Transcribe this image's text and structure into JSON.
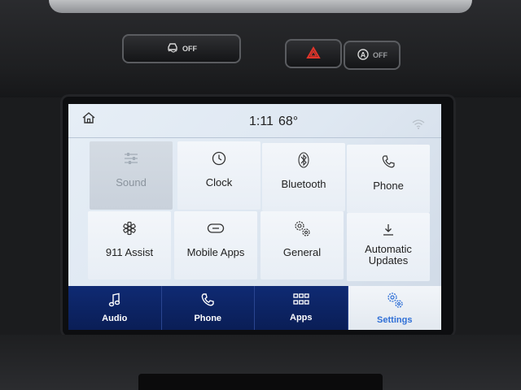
{
  "hardware_buttons": {
    "traction_off_label": "OFF",
    "hazard_icon": "hazard-triangle-icon",
    "auto_stop_label": "OFF"
  },
  "status_bar": {
    "time": "1:11",
    "temperature": "68°",
    "home_icon": "home-icon",
    "wifi_icon": "wifi-icon"
  },
  "tiles": [
    {
      "label": "Sound",
      "icon": "sliders-icon",
      "enabled": false
    },
    {
      "label": "Clock",
      "icon": "clock-icon",
      "enabled": true
    },
    {
      "label": "Bluetooth",
      "icon": "bluetooth-icon",
      "enabled": true
    },
    {
      "label": "Phone",
      "icon": "phone-icon",
      "enabled": true
    },
    {
      "label": "911 Assist",
      "icon": "asterisk-icon",
      "enabled": true
    },
    {
      "label": "Mobile Apps",
      "icon": "link-icon",
      "enabled": true
    },
    {
      "label": "General",
      "icon": "gears-icon",
      "enabled": true
    },
    {
      "label": "Automatic Updates",
      "icon": "download-icon",
      "enabled": true
    }
  ],
  "pager": {
    "pages": 2,
    "active": 1
  },
  "nav": [
    {
      "label": "Audio",
      "icon": "music-note-icon",
      "active": false
    },
    {
      "label": "Phone",
      "icon": "phone-icon",
      "active": false
    },
    {
      "label": "Apps",
      "icon": "apps-grid-icon",
      "active": false
    },
    {
      "label": "Settings",
      "icon": "gears-icon",
      "active": true
    }
  ],
  "colors": {
    "nav_bg": "#0f2a73",
    "accent_blue": "#2f6fd6",
    "hazard_red": "#e0352b"
  }
}
